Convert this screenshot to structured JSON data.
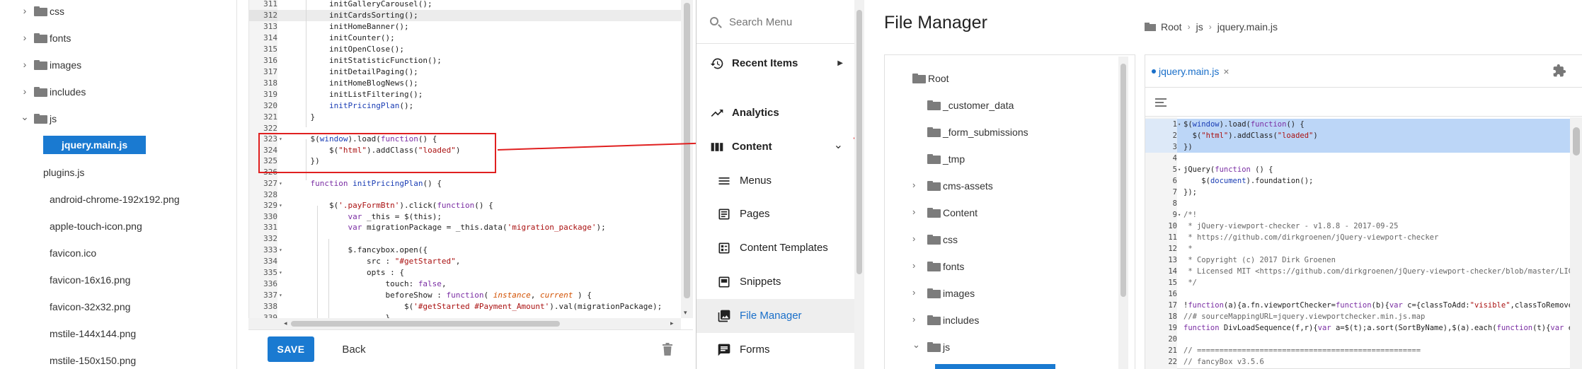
{
  "left_tree": {
    "items": [
      {
        "label": "css",
        "type": "folder",
        "expanded": false
      },
      {
        "label": "fonts",
        "type": "folder",
        "expanded": false
      },
      {
        "label": "images",
        "type": "folder",
        "expanded": false
      },
      {
        "label": "includes",
        "type": "folder",
        "expanded": false
      },
      {
        "label": "js",
        "type": "folder",
        "expanded": true
      },
      {
        "label": "jquery.main.js",
        "type": "file",
        "selected": true
      },
      {
        "label": "plugins.js",
        "type": "file"
      },
      {
        "label": "android-chrome-192x192.png",
        "type": "file"
      },
      {
        "label": "apple-touch-icon.png",
        "type": "file"
      },
      {
        "label": "favicon.ico",
        "type": "file"
      },
      {
        "label": "favicon-16x16.png",
        "type": "file"
      },
      {
        "label": "favicon-32x32.png",
        "type": "file"
      },
      {
        "label": "mstile-144x144.png",
        "type": "file"
      },
      {
        "label": "mstile-150x150.png",
        "type": "file"
      }
    ]
  },
  "editor": {
    "lines": [
      {
        "n": "311",
        "code": "        initGalleryCarousel();"
      },
      {
        "n": "312",
        "code": "        initCardsSorting();",
        "highlight": true
      },
      {
        "n": "313",
        "code": "        initHomeBanner();"
      },
      {
        "n": "314",
        "code": "        initCounter();"
      },
      {
        "n": "315",
        "code": "        initOpenClose();"
      },
      {
        "n": "316",
        "code": "        initStatisticFunction();"
      },
      {
        "n": "317",
        "code": "        initDetailPaging();"
      },
      {
        "n": "318",
        "code": "        initHomeBlogNews();"
      },
      {
        "n": "319",
        "code": "        initListFiltering();"
      },
      {
        "n": "320",
        "code": "        initPricingPlan();"
      },
      {
        "n": "321",
        "code": "    }"
      },
      {
        "n": "322",
        "code": ""
      },
      {
        "n": "323",
        "code": "    $(window).load(function() {",
        "fold": true
      },
      {
        "n": "324",
        "code": "        $(\"html\").addClass(\"loaded\")"
      },
      {
        "n": "325",
        "code": "    })"
      },
      {
        "n": "326",
        "code": ""
      },
      {
        "n": "327",
        "code": "    function initPricingPlan() {",
        "fold": true
      },
      {
        "n": "328",
        "code": ""
      },
      {
        "n": "329",
        "code": "        $('.payFormBtn').click(function() {",
        "fold": true
      },
      {
        "n": "330",
        "code": "            var _this = $(this);"
      },
      {
        "n": "331",
        "code": "            var migrationPackage = _this.data('migration_package');"
      },
      {
        "n": "332",
        "code": ""
      },
      {
        "n": "333",
        "code": "            $.fancybox.open({",
        "fold": true
      },
      {
        "n": "334",
        "code": "                src : \"#getStarted\","
      },
      {
        "n": "335",
        "code": "                opts : {",
        "fold": true
      },
      {
        "n": "336",
        "code": "                    touch: false,"
      },
      {
        "n": "337",
        "code": "                    beforeShow : function( instance, current ) {",
        "fold": true
      },
      {
        "n": "338",
        "code": "                        $('#getStarted #Payment_Amount').val(migrationPackage);"
      },
      {
        "n": "339",
        "code": "                    }"
      }
    ],
    "save_label": "SAVE",
    "back_label": "Back"
  },
  "nav": {
    "search_placeholder": "Search Menu",
    "items": [
      {
        "label": "Recent Items",
        "icon": "history-icon",
        "bold": true,
        "arrow": "right"
      },
      {
        "label": "Analytics",
        "icon": "trending-up-icon",
        "bold": true
      },
      {
        "label": "Content",
        "icon": "content-icon",
        "bold": true,
        "arrow": "down"
      },
      {
        "label": "Menus",
        "icon": "menu-lines-icon",
        "sub": true
      },
      {
        "label": "Pages",
        "icon": "pages-icon",
        "sub": true
      },
      {
        "label": "Content Templates",
        "icon": "template-icon",
        "sub": true
      },
      {
        "label": "Snippets",
        "icon": "snippet-icon",
        "sub": true
      },
      {
        "label": "File Manager",
        "icon": "photo-library-icon",
        "sub": true,
        "active": true
      },
      {
        "label": "Forms",
        "icon": "forms-icon",
        "sub": true
      }
    ]
  },
  "file_manager": {
    "title": "File Manager",
    "breadcrumb": [
      "Root",
      "js",
      "jquery.main.js"
    ],
    "tree": [
      {
        "label": "Root",
        "level": 0,
        "chevron": "none"
      },
      {
        "label": "_customer_data",
        "level": 1,
        "chevron": "none"
      },
      {
        "label": "_form_submissions",
        "level": 1,
        "chevron": "none"
      },
      {
        "label": "_tmp",
        "level": 1,
        "chevron": "none"
      },
      {
        "label": "cms-assets",
        "level": 1,
        "chevron": "right"
      },
      {
        "label": "Content",
        "level": 1,
        "chevron": "right"
      },
      {
        "label": "css",
        "level": 1,
        "chevron": "right"
      },
      {
        "label": "fonts",
        "level": 1,
        "chevron": "right"
      },
      {
        "label": "images",
        "level": 1,
        "chevron": "right"
      },
      {
        "label": "includes",
        "level": 1,
        "chevron": "right"
      },
      {
        "label": "js",
        "level": 1,
        "chevron": "down"
      }
    ],
    "tab_label": "jquery.main.js",
    "tab_close": "×",
    "code": [
      {
        "n": "1",
        "code": "$(window).load(function() {",
        "sel": true,
        "fold": "▾"
      },
      {
        "n": "2",
        "code": "  $(\"html\").addClass(\"loaded\")",
        "sel": true
      },
      {
        "n": "3",
        "code": "})",
        "sel": true
      },
      {
        "n": "4",
        "code": ""
      },
      {
        "n": "5",
        "code": "jQuery(function () {",
        "fold": "▾"
      },
      {
        "n": "6",
        "code": "    $(document).foundation();"
      },
      {
        "n": "7",
        "code": "});"
      },
      {
        "n": "8",
        "code": ""
      },
      {
        "n": "9",
        "code": "/*!",
        "fold": "▾"
      },
      {
        "n": "10",
        "code": " * jQuery-viewport-checker - v1.8.8 - 2017-09-25"
      },
      {
        "n": "11",
        "code": " * https://github.com/dirkgroenen/jQuery-viewport-checker"
      },
      {
        "n": "12",
        "code": " *"
      },
      {
        "n": "13",
        "code": " * Copyright (c) 2017 Dirk Groenen"
      },
      {
        "n": "14",
        "code": " * Licensed MIT <https://github.com/dirkgroenen/jQuery-viewport-checker/blob/master/LICE"
      },
      {
        "n": "15",
        "code": " */"
      },
      {
        "n": "16",
        "code": ""
      },
      {
        "n": "17",
        "code": "!function(a){a.fn.viewportChecker=function(b){var c={classToAdd:\"visible\",classToRemove:"
      },
      {
        "n": "18",
        "code": "//# sourceMappingURL=jquery.viewportchecker.min.js.map"
      },
      {
        "n": "19",
        "code": "function DivLoadSequence(f,r){var a=$(t);a.sort(SortByName),$(a).each(function(t){var e="
      },
      {
        "n": "20",
        "code": ""
      },
      {
        "n": "21",
        "code": "// =================================================="
      },
      {
        "n": "22",
        "code": "// fancyBox v3.5.6"
      }
    ]
  },
  "colors": {
    "accent": "#1a7ad1",
    "annotation": "#e02020",
    "selection": "#bcd6f7"
  }
}
